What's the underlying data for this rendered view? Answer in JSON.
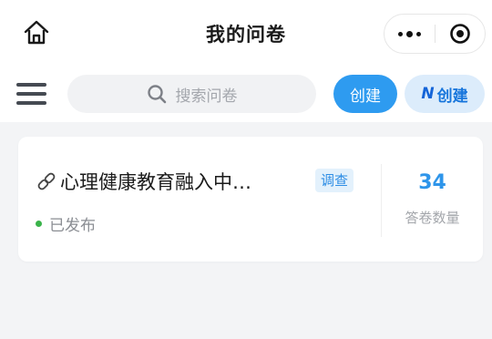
{
  "header": {
    "title": "我的问卷",
    "home_icon": "home-icon",
    "more_icon": "more-dots-icon",
    "close_icon": "target-icon"
  },
  "toolbar": {
    "menu_icon": "hamburger-menu-icon",
    "search_placeholder": "搜索问卷",
    "create_label": "创建",
    "ai_create_label": "创建",
    "ai_logo_text": "N"
  },
  "surveys": [
    {
      "title": "心理健康教育融入中…",
      "type_tag": "调查",
      "status": "已发布",
      "status_color": "#3ab34a",
      "answer_count": "34",
      "answer_count_label": "答卷数量"
    }
  ],
  "colors": {
    "accent": "#2e9bf0",
    "accent_light": "#dcecfb",
    "stat_value": "#2e95ea",
    "background": "#f3f4f6"
  }
}
